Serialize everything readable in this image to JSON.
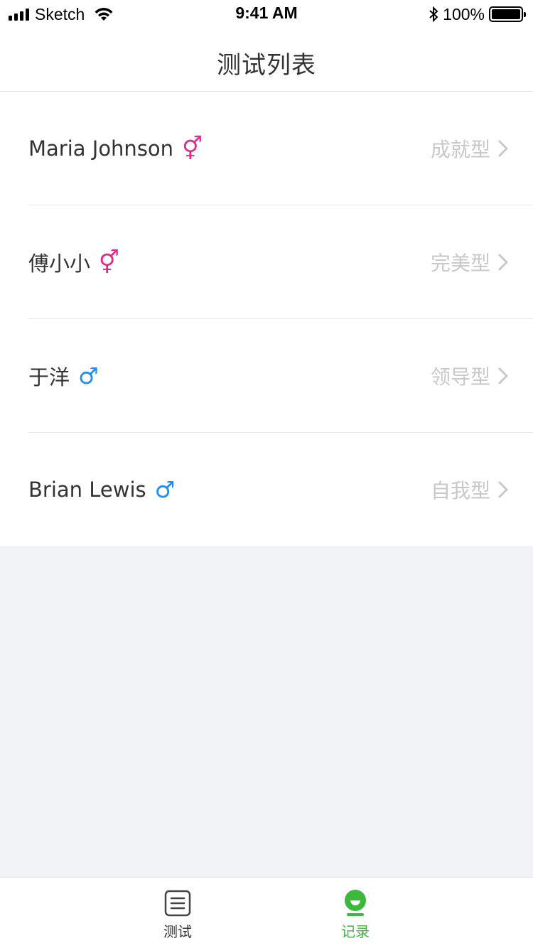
{
  "status_bar": {
    "carrier": "Sketch",
    "time": "9:41 AM",
    "battery": "100%",
    "battery_level": 1.0
  },
  "nav": {
    "title": "测试列表"
  },
  "records": [
    {
      "name": "Maria Johnson",
      "gender": "female",
      "type": "成就型"
    },
    {
      "name": "傅小小",
      "gender": "female",
      "type": "完美型"
    },
    {
      "name": "于洋",
      "gender": "male",
      "type": "领导型"
    },
    {
      "name": "Brian Lewis",
      "gender": "male",
      "type": "自我型"
    }
  ],
  "gender_icons": {
    "female": "female-symbol-icon",
    "male": "male-symbol-icon"
  },
  "colors": {
    "female": "#e6278a",
    "male": "#1d8ff2",
    "active_tab": "#3cb93c"
  },
  "tab_bar": {
    "items": [
      {
        "label": "测试",
        "icon": "list-document-icon",
        "active": false
      },
      {
        "label": "记录",
        "icon": "record-icon",
        "active": true
      }
    ]
  }
}
